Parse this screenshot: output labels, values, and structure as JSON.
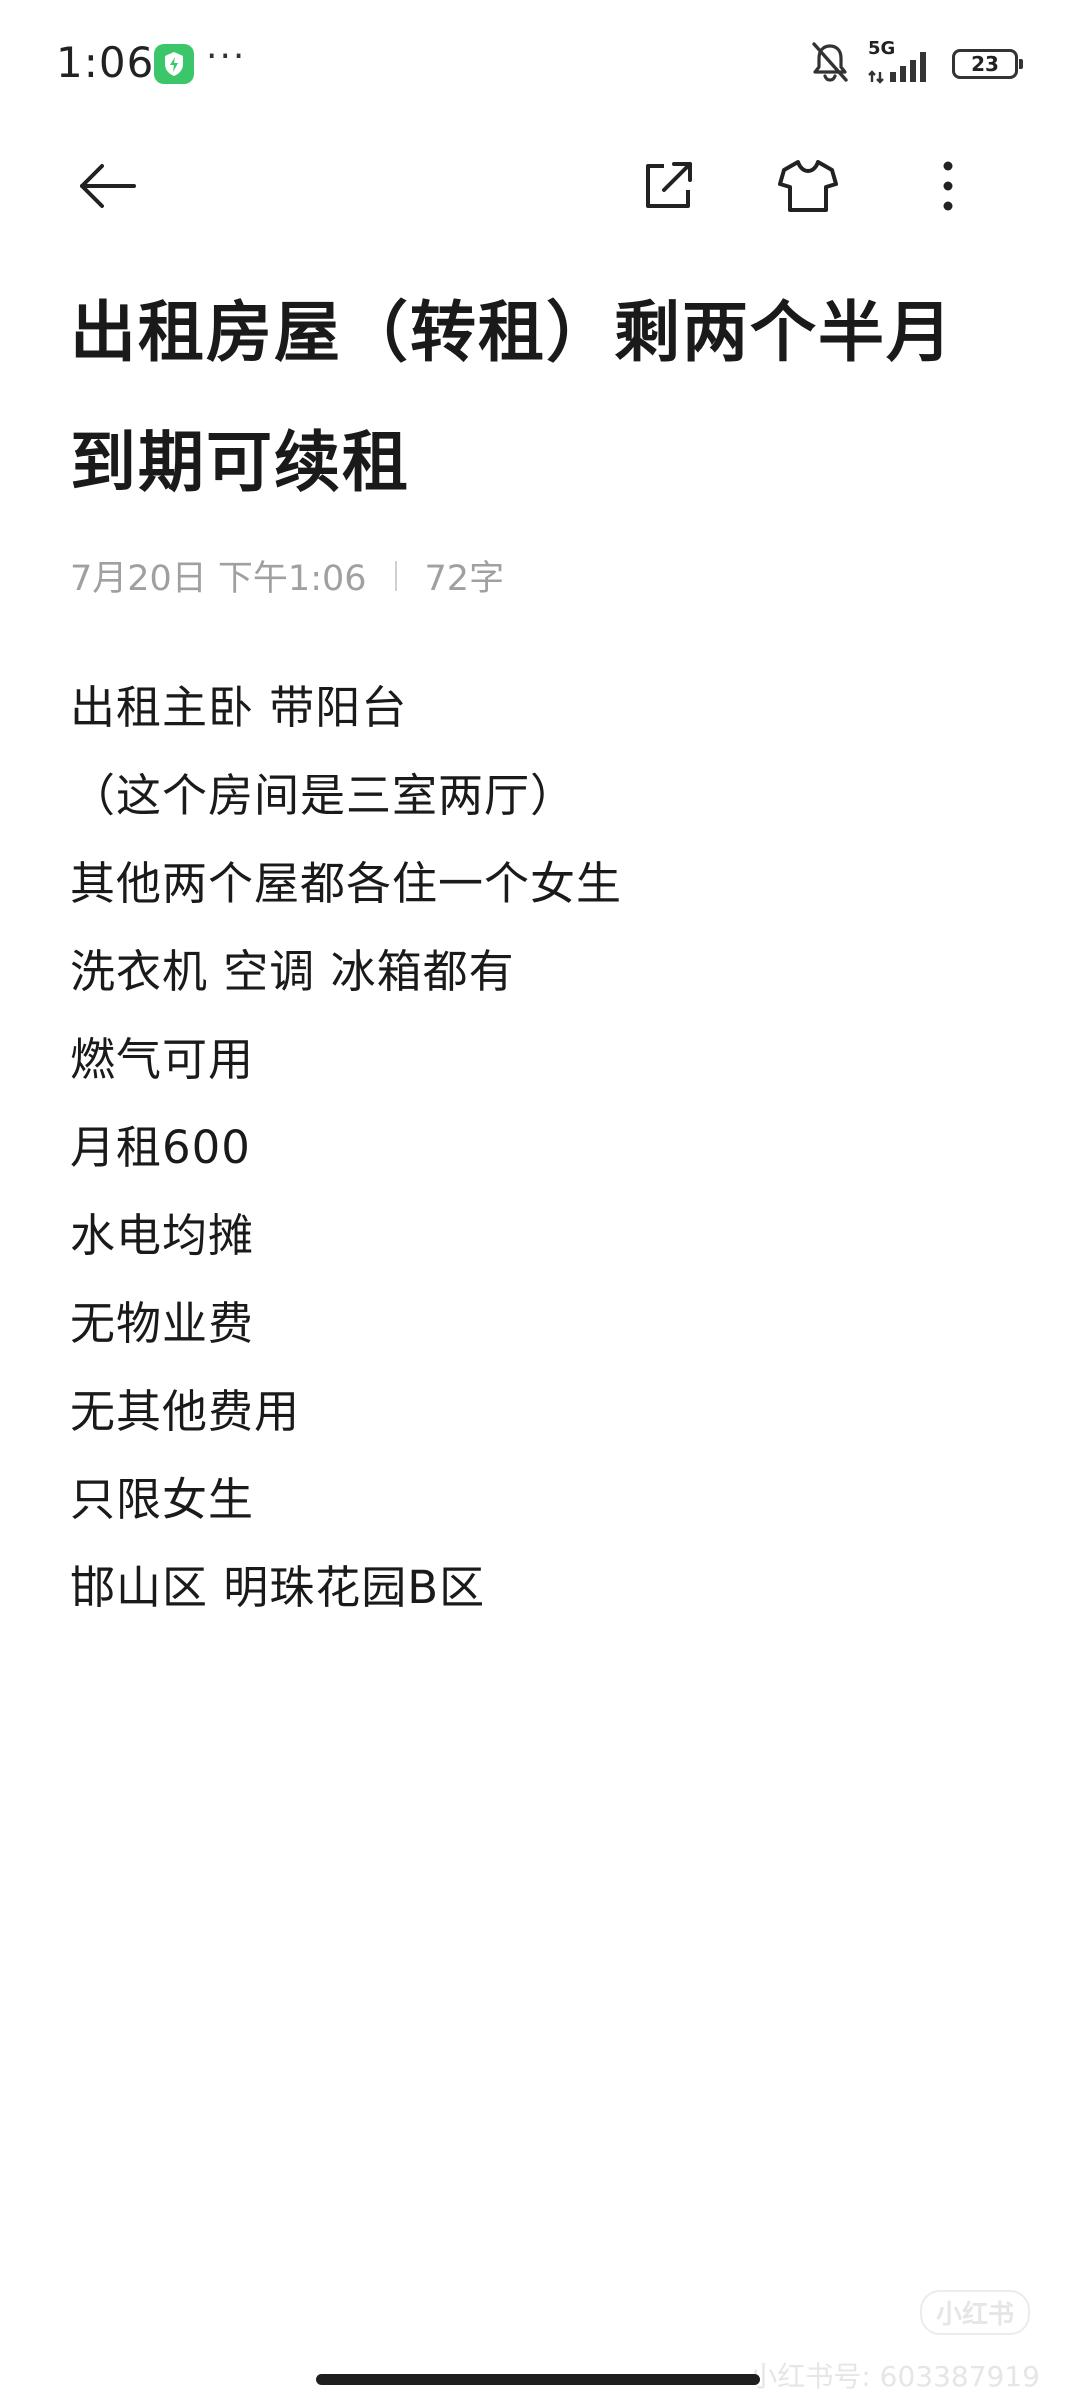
{
  "status_bar": {
    "time": "1:06",
    "more": "···",
    "network": "5G",
    "battery": "23"
  },
  "note": {
    "title": "出租房屋（转租）剩两个半月到期可续租",
    "date": "7月20日 下午1:06",
    "word_count": "72字",
    "lines": [
      "出租主卧 带阳台",
      "（这个房间是三室两厅）",
      "其他两个屋都各住一个女生",
      "洗衣机 空调 冰箱都有",
      "燃气可用",
      "月租600",
      "水电均摊",
      "无物业费",
      "无其他费用",
      "只限女生",
      "邯山区 明珠花园B区"
    ]
  },
  "watermark": {
    "logo": "小红书",
    "id": "小红书号: 603387919"
  },
  "icons": {
    "back": "arrow-left-icon",
    "share": "share-icon",
    "theme": "tshirt-icon",
    "more": "more-vertical-icon"
  }
}
